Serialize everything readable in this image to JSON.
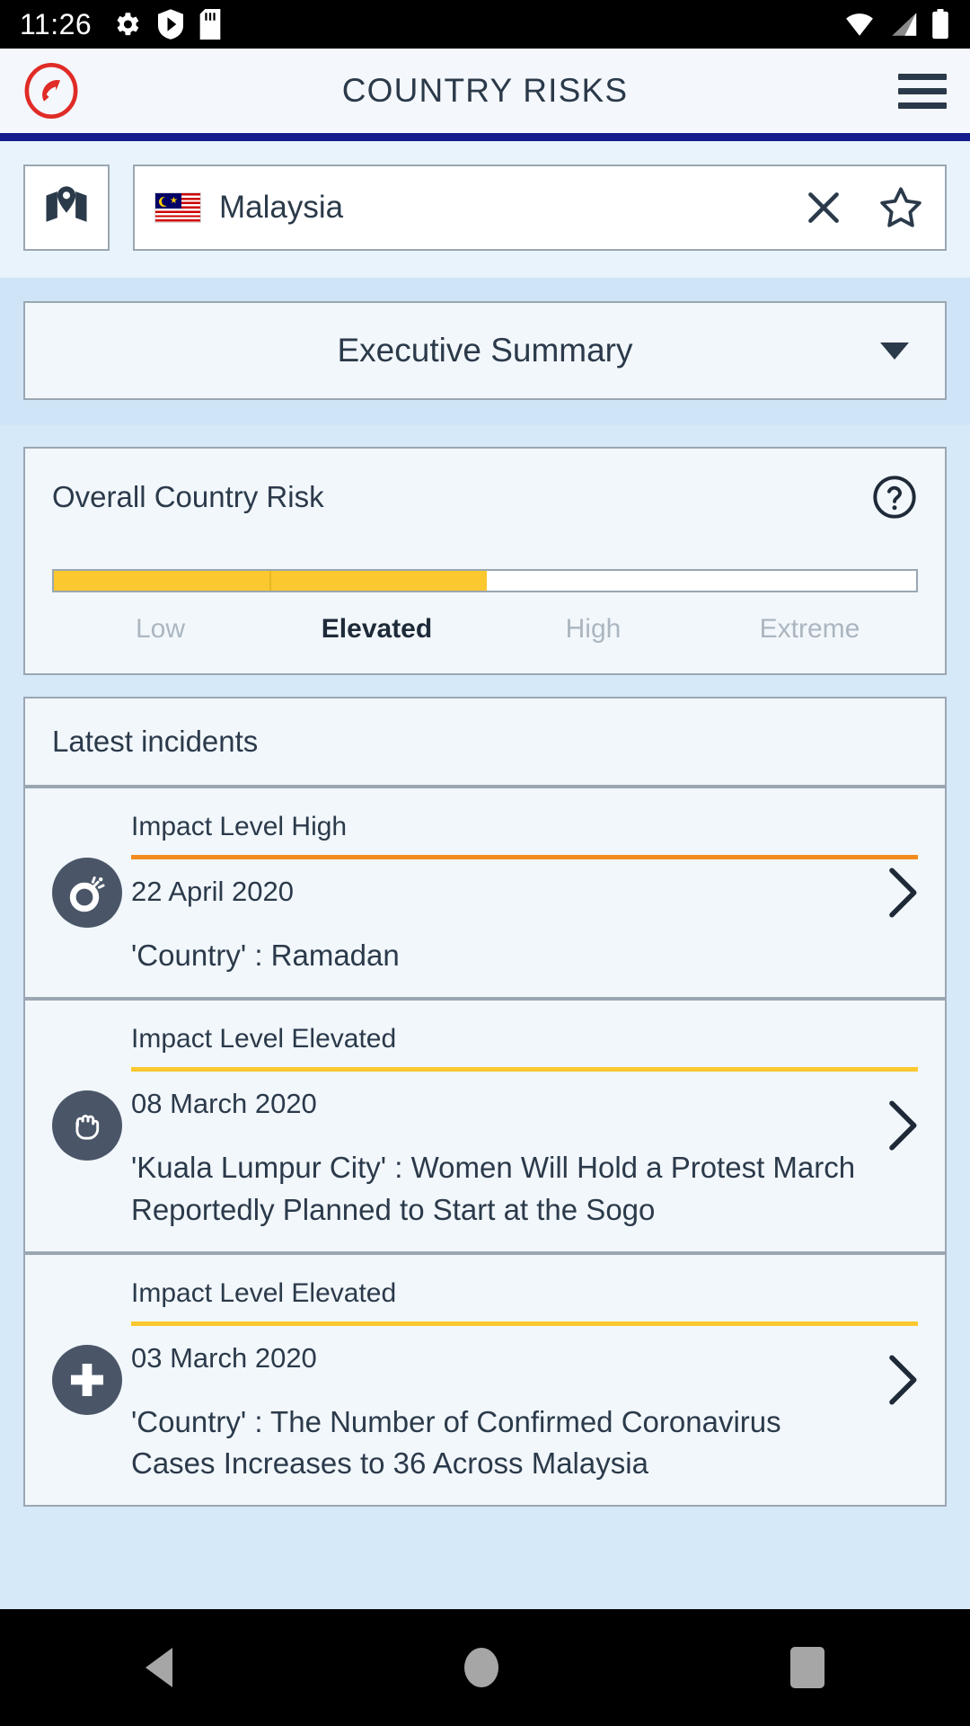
{
  "statusbar": {
    "time": "11:26",
    "left_icons": [
      "gear-icon",
      "shield-play-icon",
      "sd-card-icon"
    ],
    "right_icons": [
      "wifi-icon",
      "cellular-signal-icon",
      "battery-icon"
    ]
  },
  "appbar": {
    "logo": "phone-circle-icon",
    "title": "COUNTRY RISKS",
    "menu": "hamburger-menu-icon",
    "accent_color": "#151B8D"
  },
  "search": {
    "map_button": "map-pin-icon",
    "country": "Malaysia",
    "flag": "malaysia-flag",
    "clear": "close-icon",
    "favorite": "star-outline-icon"
  },
  "executive_summary": {
    "label": "Executive Summary",
    "caret": "chevron-down-icon"
  },
  "overall_risk": {
    "title": "Overall Country Risk",
    "help": "help-circle-icon",
    "levels": [
      "Low",
      "Elevated",
      "High",
      "Extreme"
    ],
    "current_level": "Elevated",
    "fill_percent": 50,
    "fill_color": "#FBC82F",
    "track_color": "#FFFFFF"
  },
  "latest_incidents": {
    "title": "Latest incidents",
    "items": [
      {
        "impact": "Impact Level High",
        "impact_color": "#F28C1E",
        "date": "22 April 2020",
        "text": "'Country' : Ramadan",
        "icon": "bomb-icon",
        "chevron": "chevron-right-icon"
      },
      {
        "impact": "Impact Level Elevated",
        "impact_color": "#FBC82F",
        "date": "08 March 2020",
        "text": "'Kuala Lumpur City' : Women Will Hold a Protest March Reportedly Planned to Start at the Sogo",
        "icon": "raised-fist-icon",
        "chevron": "chevron-right-icon"
      },
      {
        "impact": "Impact Level Elevated",
        "impact_color": "#FBC82F",
        "date": "03 March 2020",
        "text": "'Country' : The Number of Confirmed Coronavirus Cases Increases to 36 Across Malaysia",
        "icon": "medical-cross-icon",
        "chevron": "chevron-right-icon"
      }
    ]
  },
  "navbar": {
    "back": "back-triangle-icon",
    "home": "home-circle-icon",
    "recents": "recents-square-icon"
  }
}
